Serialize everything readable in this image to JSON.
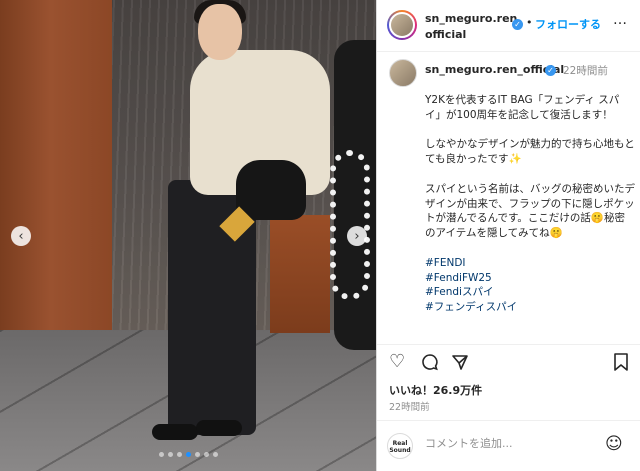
{
  "post": {
    "carousel": {
      "slide_count": 7,
      "active_index": 3
    },
    "header": {
      "username_line1": "sn_meguro.ren_",
      "username_line2": "official",
      "separator": "•",
      "follow_label": "フォローする",
      "more_label": "…"
    },
    "caption": {
      "username": "sn_meguro.ren_official",
      "time": "22時間前",
      "paragraphs": [
        "Y2Kを代表するIT BAG「フェンディ スパイ」が100周年を記念して復活します！",
        "しなやかなデザインが魅力的で持ち心地もとても良かったです✨",
        "スパイという名前は、バッグの秘密めいたデザインが由来で、フラップの下に隠しポケットが潜んでるんです。ここだけの話🤫秘密のアイテムを隠してみてね🤫"
      ],
      "hashtags": [
        "#FENDI",
        "#FendiFW25",
        "#Fendiスパイ",
        "#フェンディスパイ"
      ]
    },
    "likes": "いいね！26.9万件",
    "posted_time": "22時間前",
    "comment": {
      "badge": "Real Sound",
      "placeholder": "コメントを追加..."
    }
  }
}
